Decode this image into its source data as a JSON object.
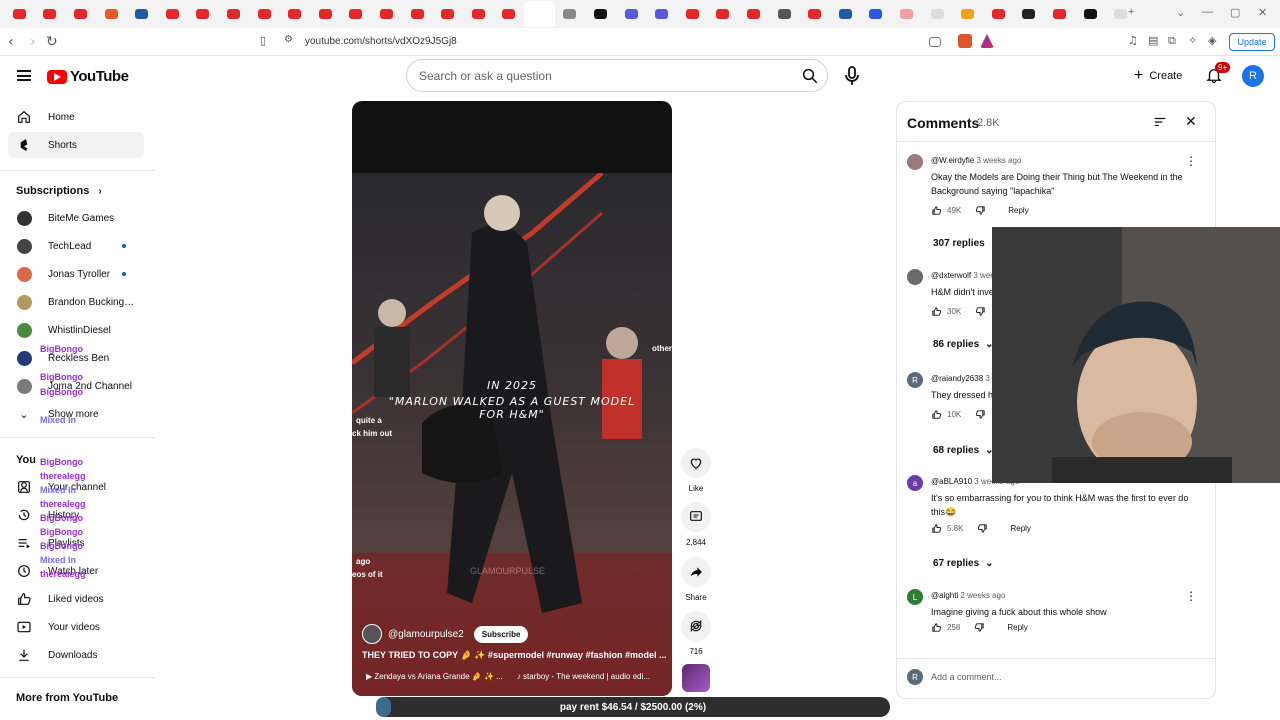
{
  "browser": {
    "url": "youtube.com/shorts/vdXOz9J5Gj8",
    "update_label": "Update",
    "tab_count": 37
  },
  "header": {
    "logo_text": "YouTube",
    "search_placeholder": "Search or ask a question",
    "create_label": "Create",
    "notifications_badge": "9+",
    "avatar_letter": "R"
  },
  "sidebar": {
    "main": [
      {
        "label": "Home",
        "icon": "home-icon"
      },
      {
        "label": "Shorts",
        "icon": "shorts-icon"
      }
    ],
    "subscriptions_heading": "Subscriptions",
    "subscriptions": [
      {
        "label": "BiteMe Games",
        "color": "#333333",
        "live": false
      },
      {
        "label": "TechLead",
        "color": "#444444",
        "live": true
      },
      {
        "label": "Jonas Tyroller",
        "color": "#d86a4a",
        "live": true
      },
      {
        "label": "Brandon Buckingha...",
        "color": "#b09a60",
        "live": false
      },
      {
        "label": "WhistlinDiesel",
        "color": "#4a8a3a",
        "live": false
      },
      {
        "label": "Reckless Ben",
        "color": "#233a7a",
        "live": false
      },
      {
        "label": "Joma 2nd Channel",
        "color": "#7a7a7a",
        "live": false
      }
    ],
    "show_more": "Show more",
    "you_heading": "You",
    "you_items": [
      {
        "label": "Your channel",
        "icon": "user-icon"
      },
      {
        "label": "History",
        "icon": "history-icon"
      },
      {
        "label": "Playlists",
        "icon": "playlist-icon"
      },
      {
        "label": "Watch later",
        "icon": "clock-icon"
      },
      {
        "label": "Liked videos",
        "icon": "thumbs-up-icon"
      },
      {
        "label": "Your videos",
        "icon": "video-icon"
      },
      {
        "label": "Downloads",
        "icon": "download-icon"
      }
    ],
    "more_heading": "More from YouTube"
  },
  "chat_overlay": [
    {
      "name": "BigBongo",
      "color": "#9b30d9"
    },
    {
      "name": "BigBongo",
      "color": "#9b30d9"
    },
    {
      "name": "BigBongo",
      "color": "#9b30d9"
    },
    {
      "name": "Mixed In",
      "color": "#7b6be8"
    },
    {
      "name": "BigBongo",
      "color": "#9b30d9"
    },
    {
      "name": "therealegg",
      "color": "#9b30d9"
    },
    {
      "name": "Mixed In",
      "color": "#7b6be8"
    },
    {
      "name": "therealegg",
      "color": "#9b30d9"
    },
    {
      "name": "BigBongo",
      "color": "#9b30d9"
    },
    {
      "name": "BigBongo",
      "color": "#9b30d9"
    },
    {
      "name": "BigBongo",
      "color": "#9b30d9"
    },
    {
      "name": "Mixed In",
      "color": "#7b6be8"
    },
    {
      "name": "therealegg",
      "color": "#9b30d9"
    }
  ],
  "video": {
    "caption_line1": "IN 2025",
    "caption_line2": "\"MARLON WALKED AS A GUEST MODEL",
    "caption_line3": "FOR H&M\"",
    "side_text1": "other",
    "side_text2": "quite a",
    "side_text3": "ck him out",
    "side_text4": "ago",
    "side_text5": "eos of it",
    "watermark": "GLAMOURPULSE",
    "channel": "@glamourpulse2",
    "subscribe_label": "Subscribe",
    "title": "THEY TRIED TO COPY 🤌 ✨ #supermodel #runway #fashion #model ...",
    "tag1": "▶ Zendaya vs Ariana Grande 🤌 ✨ ...",
    "tag2": "♪ starboy - The weekend | audio edi..."
  },
  "actions": {
    "like_label": "Like",
    "comments_count": "2,844",
    "share_label": "Share",
    "remix_count": "716"
  },
  "comments": {
    "title": "Comments",
    "count": "2.8K",
    "items": [
      {
        "author": "@W.eirdyfie",
        "ago": "3 weeks ago",
        "text": "Okay the Models are Doing their Thing but The Weekend in the Background saying \"lapachika\"",
        "likes": "49K",
        "replies": "307 replies",
        "avatar_color": "#9a7a7a",
        "avatar_letter": ""
      },
      {
        "author": "@dxterwolf",
        "ago": "3 weeks ago",
        "text": "H&M didn't inve",
        "likes": "30K",
        "replies": "86 replies",
        "avatar_color": "#6a6a6a",
        "avatar_letter": ""
      },
      {
        "author": "@raiandy2638",
        "ago": "3 weeks ago",
        "text": "They dressed h",
        "likes": "10K",
        "replies": "68 replies",
        "avatar_color": "#5a6a7a",
        "avatar_letter": "R"
      },
      {
        "author": "@aBLA910",
        "ago": "3 weeks ago",
        "text": "It's so embarrassing for you  to think H&M was the first to ever do this😂",
        "likes": "5.8K",
        "replies": "67 replies",
        "avatar_color": "#6a3ab0",
        "avatar_letter": "a"
      },
      {
        "author": "@aighti",
        "ago": "2 weeks ago",
        "text": "Imagine giving a fuck about this whole show",
        "likes": "258",
        "replies": "",
        "avatar_color": "#2e7d32",
        "avatar_letter": "L"
      }
    ],
    "reply_label": "Reply",
    "add_placeholder": "Add a comment...",
    "add_avatar": "R"
  },
  "overlay": {
    "rent_text": "pay rent $46.54 / $2500.00 (2%)",
    "rent_progress": 0.02
  },
  "colors": {
    "brand_red": "#ff0000",
    "link_blue": "#065fd4"
  }
}
